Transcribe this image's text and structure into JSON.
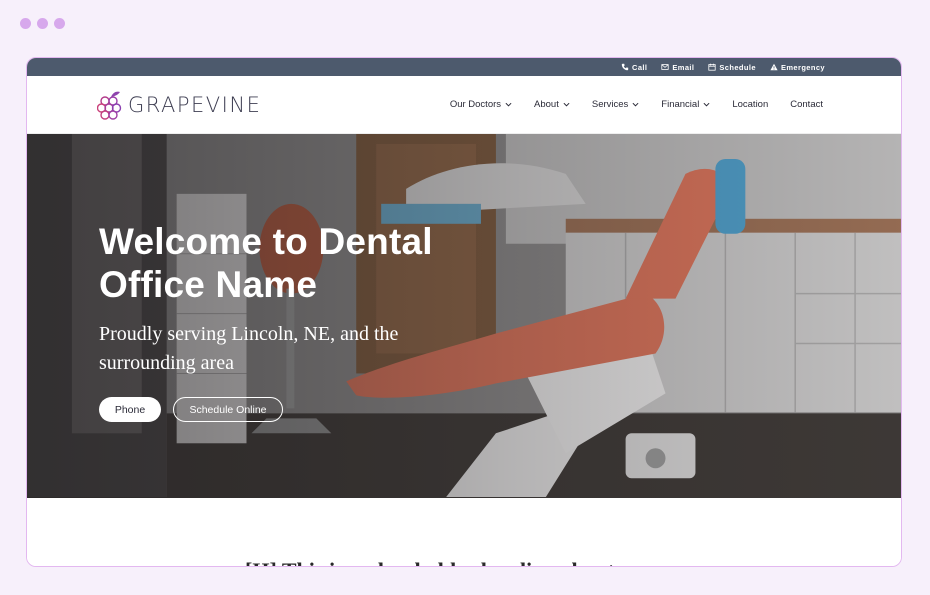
{
  "window": {
    "dots": 3
  },
  "topbar": {
    "items": [
      {
        "label": "Call",
        "icon": "phone-icon"
      },
      {
        "label": "Email",
        "icon": "email-icon"
      },
      {
        "label": "Schedule",
        "icon": "calendar-icon"
      },
      {
        "label": "Emergency",
        "icon": "warning-icon"
      }
    ]
  },
  "logo": {
    "text": "GRAPEVINE"
  },
  "nav": {
    "items": [
      {
        "label": "Our Doctors",
        "dropdown": true
      },
      {
        "label": "About",
        "dropdown": true
      },
      {
        "label": "Services",
        "dropdown": true
      },
      {
        "label": "Financial",
        "dropdown": true
      },
      {
        "label": "Location",
        "dropdown": false
      },
      {
        "label": "Contact",
        "dropdown": false
      }
    ]
  },
  "hero": {
    "title": "Welcome to Dental Office Name",
    "subtitle": "Proudly serving Lincoln, NE, and the surrounding area",
    "phone_button": "Phone",
    "schedule_button": "Schedule Online"
  },
  "below": {
    "heading_partial": "[H] This is a placeholder heading about"
  },
  "colors": {
    "page_bg": "#f7f0fb",
    "topbar_bg": "#4d5a6d",
    "dot": "#d7a8ec",
    "border": "#e3b8f0",
    "chair": "#d9735a"
  }
}
